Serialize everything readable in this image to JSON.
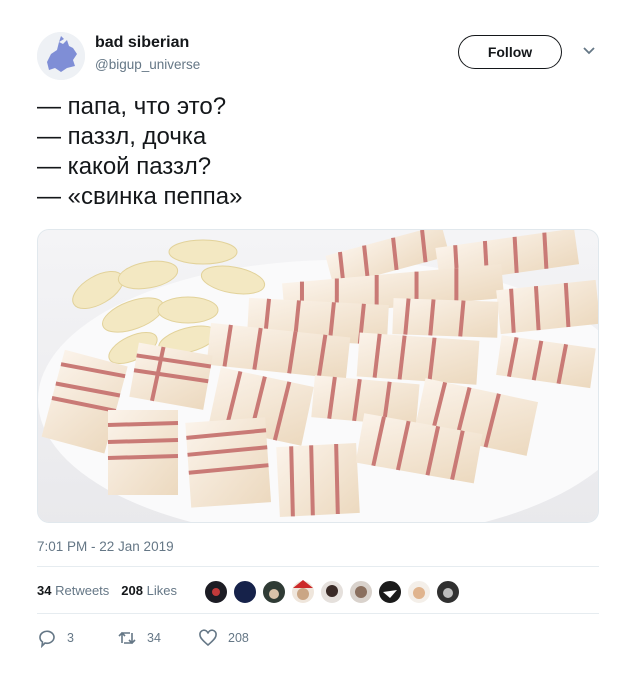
{
  "user": {
    "name": "bad siberian",
    "handle": "@bigup_universe"
  },
  "follow_label": "Follow",
  "tweet_lines": [
    "— папа, что это?",
    "— паззл, дочка",
    "— какой паззл?",
    "— «свинка пеппа»"
  ],
  "timestamp": "7:01 PM - 22 Jan 2019",
  "stats": {
    "retweets_count": "34",
    "retweets_label": "Retweets",
    "likes_count": "208",
    "likes_label": "Likes"
  },
  "actions": {
    "replies": "3",
    "retweets": "34",
    "likes": "208"
  },
  "icons": {
    "caret": "chevron-down-icon",
    "reply": "reply-icon",
    "retweet": "retweet-icon",
    "like": "heart-icon"
  },
  "colors": {
    "muted": "#657786",
    "text": "#14171a",
    "rule": "#e6ecf0"
  }
}
